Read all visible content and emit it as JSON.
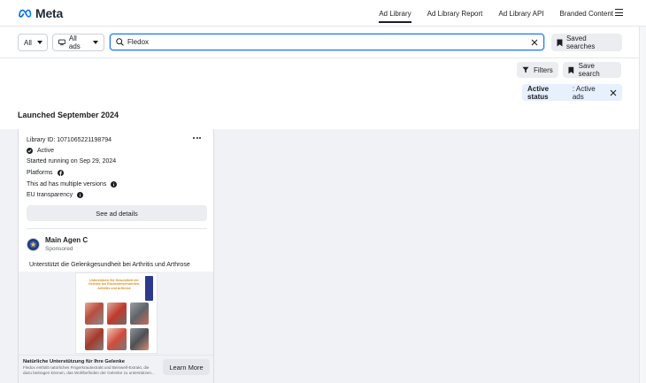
{
  "header": {
    "logo_text": "Meta",
    "nav": [
      {
        "label": "Ad Library",
        "active": true
      },
      {
        "label": "Ad Library Report",
        "active": false
      },
      {
        "label": "Ad Library API",
        "active": false
      },
      {
        "label": "Branded Content",
        "active": false
      }
    ],
    "menu_icon": "hamburger-icon"
  },
  "search": {
    "country_value": "All",
    "ad_type_value": "All ads",
    "query": "Fledox",
    "saved_searches_label": "Saved searches"
  },
  "filters": {
    "filters_label": "Filters",
    "save_search_label": "Save search",
    "status_chip": {
      "key": "Active status",
      "value": ": Active ads"
    }
  },
  "results": {
    "section_title": "Launched September 2024",
    "card": {
      "library_id": "Library ID: 1071065221198794",
      "status": "Active",
      "started": "Started running on Sep 29, 2024",
      "platforms_label": "Platforms",
      "versions_note": "This ad has multiple versions",
      "eu_label": "EU transparency",
      "see_details_label": "See ad details",
      "advertiser_name": "Main Agen C",
      "sponsored_label": "Sponsored",
      "ad_text": "Unterstützt die Gelenkgesundheit bei Arthritis und Arthrose",
      "creative_headline": "Unterstützen Sie Gesundheit der Gelenke bei Rückenbeschwerden, Arthritis und Arthrose",
      "cta_title": "Natürliche Unterstützung für Ihre Gelenke",
      "cta_description": "Fledox enthält natürliches Fingerkrautextrakt und Beinwell-Extrakt, die dazu beitragen können, das Wohlbefinden der Gelenke zu unterstützen...",
      "cta_button": "Learn More"
    }
  },
  "colors": {
    "accent": "#1877f2",
    "chip_bg": "#e7f0fd",
    "button_bg": "#ebedf0",
    "canvas_bg": "#f0f2f5"
  }
}
